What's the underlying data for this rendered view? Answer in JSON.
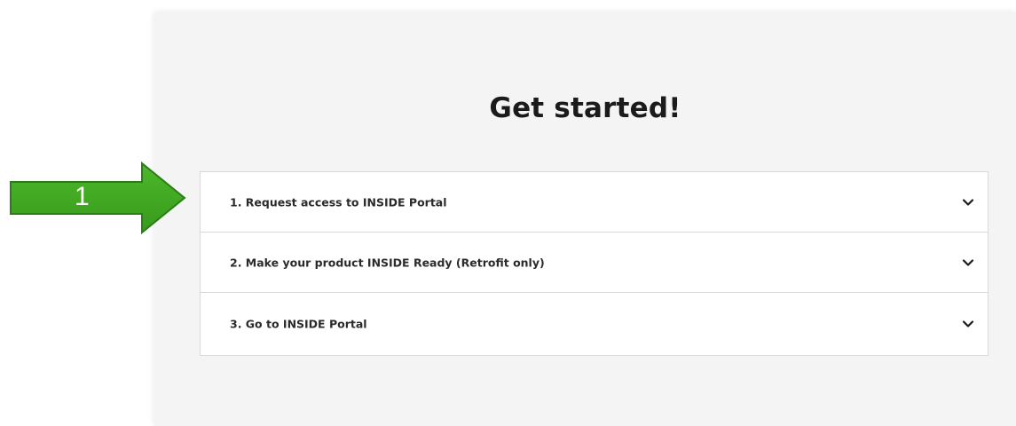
{
  "panel": {
    "title": "Get started!"
  },
  "accordion": {
    "items": [
      {
        "label": "1. Request access to INSIDE Portal",
        "expanded": false
      },
      {
        "label": "2. Make your product INSIDE Ready (Retrofit only)",
        "expanded": false
      },
      {
        "label": "3. Go to INSIDE Portal",
        "expanded": false
      }
    ]
  },
  "annotation": {
    "number": "1",
    "arrow_color": "#3aa11e",
    "arrow_border_color": "#2b7d15"
  },
  "icons": {
    "expand": "chevron-down-icon"
  }
}
